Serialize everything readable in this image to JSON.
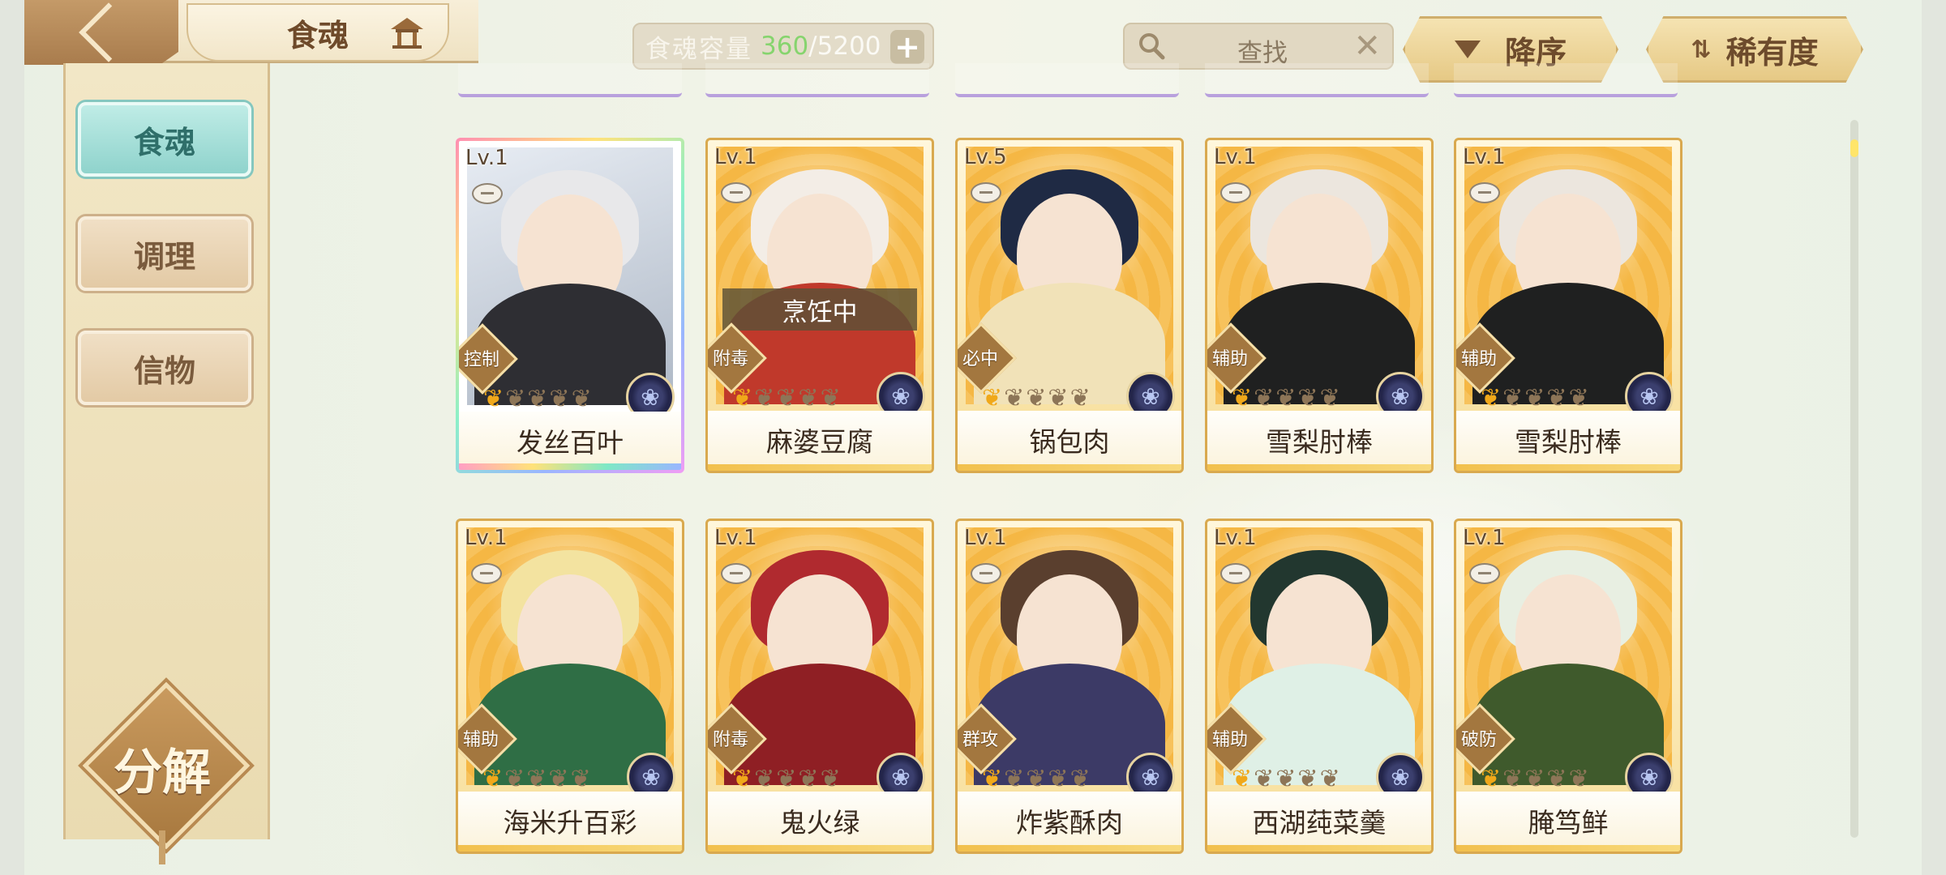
{
  "header": {
    "title": "食魂",
    "capacity_label": "食魂容量",
    "capacity_current": "360",
    "capacity_max": "/5200",
    "capacity_plus": "+",
    "search_placeholder": "查找",
    "search_clear": "✕",
    "sort_order": "降序",
    "sort_field": "稀有度"
  },
  "sidebar": {
    "items": [
      {
        "label": "食魂",
        "active": true
      },
      {
        "label": "调理",
        "active": false
      },
      {
        "label": "信物",
        "active": false
      }
    ],
    "decompose_label": "分解"
  },
  "cards": [
    {
      "level": "Lv.1",
      "role": "控制",
      "name": "发丝百叶",
      "stars_filled": 1,
      "stars_total": 5,
      "frame": "rainbow",
      "hair": "#e8e8ea",
      "body": "#2e2e33",
      "status": ""
    },
    {
      "level": "Lv.1",
      "role": "附毒",
      "name": "麻婆豆腐",
      "stars_filled": 1,
      "stars_total": 5,
      "frame": "gold",
      "hair": "#f3ede6",
      "body": "#c0392b",
      "status": "烹饪中"
    },
    {
      "level": "Lv.5",
      "role": "必中",
      "name": "锅包肉",
      "stars_filled": 1,
      "stars_total": 5,
      "frame": "gold",
      "hair": "#1f2a44",
      "body": "#f1e2b8",
      "status": ""
    },
    {
      "level": "Lv.1",
      "role": "辅助",
      "name": "雪梨肘棒",
      "stars_filled": 1,
      "stars_total": 5,
      "frame": "gold",
      "hair": "#ece6de",
      "body": "#1f2020",
      "status": ""
    },
    {
      "level": "Lv.1",
      "role": "辅助",
      "name": "雪梨肘棒",
      "stars_filled": 1,
      "stars_total": 5,
      "frame": "gold",
      "hair": "#ece6de",
      "body": "#1f2020",
      "status": ""
    },
    {
      "level": "Lv.1",
      "role": "辅助",
      "name": "海米升百彩",
      "stars_filled": 1,
      "stars_total": 5,
      "frame": "gold",
      "hair": "#f3e3a0",
      "body": "#2f6e45",
      "status": ""
    },
    {
      "level": "Lv.1",
      "role": "附毒",
      "name": "鬼火绿",
      "stars_filled": 1,
      "stars_total": 5,
      "frame": "gold",
      "hair": "#b02a2f",
      "body": "#8f1f24",
      "status": ""
    },
    {
      "level": "Lv.1",
      "role": "群攻",
      "name": "炸紫酥肉",
      "stars_filled": 1,
      "stars_total": 5,
      "frame": "gold",
      "hair": "#5a3f2e",
      "body": "#3c3a66",
      "status": ""
    },
    {
      "level": "Lv.1",
      "role": "辅助",
      "name": "西湖莼菜羹",
      "stars_filled": 1,
      "stars_total": 5,
      "frame": "gold",
      "hair": "#22372f",
      "body": "#dff0e6",
      "status": ""
    },
    {
      "level": "Lv.1",
      "role": "破防",
      "name": "腌笃鲜",
      "stars_filled": 1,
      "stars_total": 5,
      "frame": "gold",
      "hair": "#e8efe2",
      "body": "#3f5a2c",
      "status": ""
    }
  ],
  "icons": {
    "back": "chevron-left-icon",
    "home": "pavilion-icon",
    "search": "magnifier-icon",
    "medal": "flower-medal-icon"
  }
}
